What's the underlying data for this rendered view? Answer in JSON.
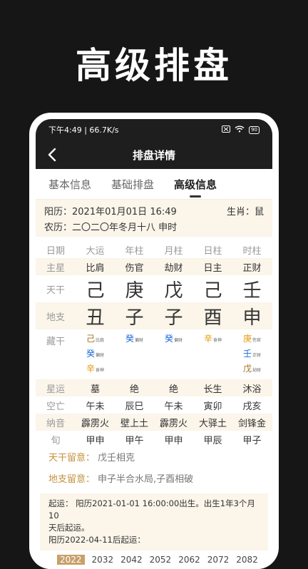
{
  "promo_title": "高级排盘",
  "status_bar": {
    "left": "下午4:49 | 66.7K/s",
    "battery": "90"
  },
  "header": {
    "title": "排盘详情"
  },
  "tabs": [
    "基本信息",
    "基础排盘",
    "高级信息"
  ],
  "active_tab": 2,
  "info": {
    "solar_label": "阳历：",
    "solar_value": "2021年01月01日 16:49",
    "zodiac_label": "生肖：",
    "zodiac_value": "鼠",
    "lunar_label": "农历：",
    "lunar_value": "二〇二〇年冬月十八 申时"
  },
  "columns": [
    "日期",
    "大运",
    "年柱",
    "月柱",
    "日柱",
    "时柱"
  ],
  "zhuxing": {
    "label": "主星",
    "values": [
      "比肩",
      "伤官",
      "劫财",
      "日主",
      "正财"
    ]
  },
  "tiangan": {
    "label": "天干",
    "values": [
      "己",
      "庚",
      "戊",
      "己",
      "壬"
    ]
  },
  "dizhi": {
    "label": "地支",
    "values": [
      "丑",
      "子",
      "子",
      "酉",
      "申"
    ]
  },
  "canggan": {
    "label": "藏干",
    "cols": [
      [
        {
          "c": "己",
          "t": "比肩"
        },
        {
          "c": "癸",
          "t": "偏财"
        },
        {
          "c": "辛",
          "t": "食神"
        }
      ],
      [
        {
          "c": "癸",
          "t": "偏财"
        }
      ],
      [
        {
          "c": "癸",
          "t": "偏财"
        }
      ],
      [
        {
          "c": "辛",
          "t": "食神"
        }
      ],
      [
        {
          "c": "庚",
          "t": "伤官"
        },
        {
          "c": "壬",
          "t": "正财"
        },
        {
          "c": "戊",
          "t": "劫财"
        }
      ]
    ]
  },
  "xingyun": {
    "label": "星运",
    "values": [
      "墓",
      "绝",
      "绝",
      "长生",
      "沐浴"
    ]
  },
  "kongwang": {
    "label": "空亡",
    "values": [
      "午未",
      "辰巳",
      "午未",
      "寅卯",
      "戌亥"
    ]
  },
  "nayin": {
    "label": "纳音",
    "values": [
      "霹雳火",
      "壁上土",
      "霹雳火",
      "大驿土",
      "剑锋金"
    ]
  },
  "xun": {
    "label": "旬",
    "values": [
      "甲申",
      "甲午",
      "甲申",
      "甲辰",
      "甲子"
    ]
  },
  "tiangan_liuyi": {
    "label": "天干留意：",
    "value": "戊壬相克"
  },
  "dizhi_liuyi": {
    "label": "地支留意：",
    "value": "申子半合水局,子酉相破"
  },
  "qiyun": {
    "line1": "起运：  阳历2021-01-01 16:00:00出生。出生1年3个月10",
    "line2": "天后起运。",
    "line3": "阳历2022-04-11后起运："
  },
  "years": [
    "2022",
    "2032",
    "2042",
    "2052",
    "2062",
    "2072",
    "2082"
  ],
  "active_year": 0,
  "colors": {
    "earth": "#b2670e",
    "metal_light": "#e59a0b",
    "water": "#1a6bd6",
    "accent_bg": "#fbf5ea"
  }
}
